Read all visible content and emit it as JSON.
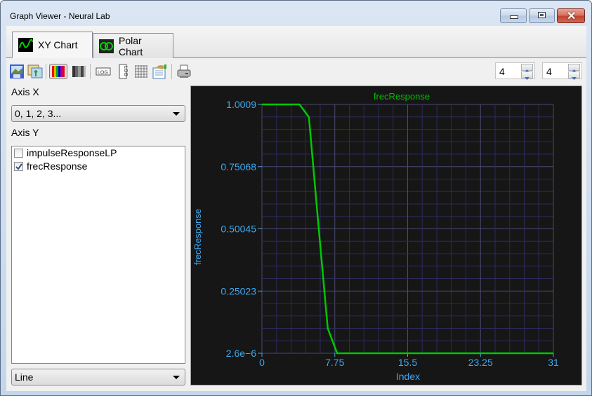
{
  "window": {
    "title": "Graph Viewer - Neural Lab",
    "buttons": [
      "minimize",
      "maximize",
      "close"
    ]
  },
  "tabs": [
    {
      "label": "XY Chart",
      "icon": "sine-wave-icon",
      "active": true
    },
    {
      "label": "Polar Chart",
      "icon": "polar-icon",
      "active": false
    }
  ],
  "toolbar": {
    "icons": [
      "save-image-icon",
      "copy-image-icon",
      "color-palette-icon",
      "grayscale-palette-icon",
      "log-x-icon",
      "log-y-icon",
      "grid-icon",
      "properties-icon",
      "print-icon"
    ],
    "spinner1": {
      "value": "4"
    },
    "spinner2": {
      "value": "4"
    }
  },
  "left_panel": {
    "axis_x_label": "Axis X",
    "axis_x_value": "0, 1, 2, 3...",
    "axis_y_label": "Axis Y",
    "series": [
      {
        "name": "impulseResponseLP",
        "checked": false
      },
      {
        "name": "frecResponse",
        "checked": true
      }
    ],
    "chart_type_value": "Line"
  },
  "colors": {
    "plot_bg": "#161616",
    "grid": "#2c2a5a",
    "grid_major": "#4a4870",
    "line": "#00c800",
    "axis_text": "#3ea8f0",
    "title_text": "#00c000"
  },
  "chart_data": {
    "type": "line",
    "title": "frecResponse",
    "xlabel": "Index",
    "ylabel": "frecResponse",
    "xlim": [
      0,
      31
    ],
    "ylim": [
      2.6e-06,
      1.0009
    ],
    "xticks": [
      "0",
      "7.75",
      "15.5",
      "23.25",
      "31"
    ],
    "yticks": [
      "2.6e−6",
      "0.25023",
      "0.50045",
      "0.75068",
      "1.0009"
    ],
    "grid": true,
    "series": [
      {
        "name": "frecResponse",
        "x": [
          0,
          1,
          2,
          3,
          4,
          5,
          6,
          7,
          8,
          9,
          10,
          11,
          12,
          13,
          14,
          15,
          16,
          17,
          18,
          19,
          20,
          21,
          22,
          23,
          24,
          25,
          26,
          27,
          28,
          29,
          30,
          31
        ],
        "y": [
          1.0009,
          1.0009,
          1.0009,
          1.0009,
          1.0009,
          0.95,
          0.52,
          0.1,
          2.6e-06,
          2.6e-06,
          2.6e-06,
          2.6e-06,
          2.6e-06,
          2.6e-06,
          2.6e-06,
          2.6e-06,
          2.6e-06,
          2.6e-06,
          2.6e-06,
          2.6e-06,
          2.6e-06,
          2.6e-06,
          2.6e-06,
          2.6e-06,
          2.6e-06,
          2.6e-06,
          2.6e-06,
          2.6e-06,
          2.6e-06,
          2.6e-06,
          2.6e-06,
          2.6e-06
        ]
      }
    ]
  }
}
